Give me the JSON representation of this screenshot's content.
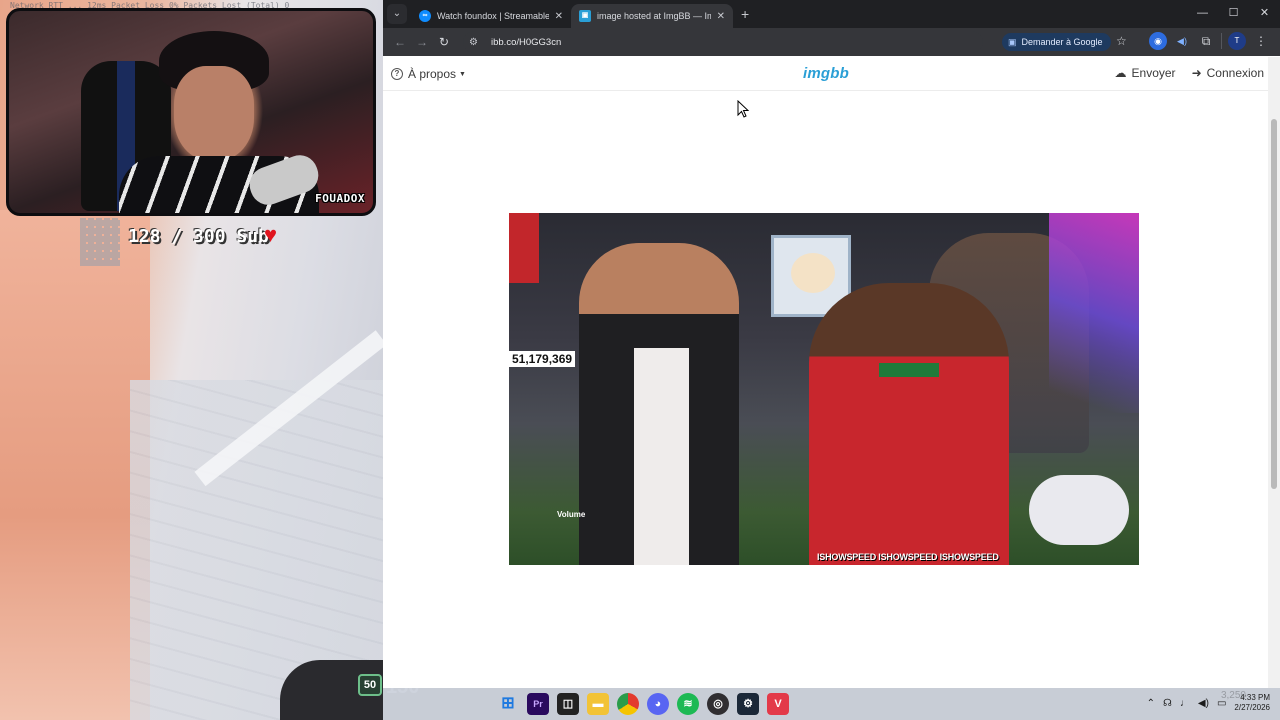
{
  "stream_overlay": {
    "stats_line": "Network RTT ... 12ms Packet Loss 0% Packets Lost (Total) 0",
    "cam_name": "FOUADOX",
    "sub_goal": "128 / 300 Sub",
    "hud_number": "50",
    "hud_ghost": "150"
  },
  "browser": {
    "tabs": [
      {
        "title": "Watch foundox | Streamable",
        "favicon": "streamable-icon",
        "active": false
      },
      {
        "title": "image hosted at ImgBB — ImgBB",
        "favicon": "imgbb-icon",
        "active": true
      }
    ],
    "url": "ibb.co/H0GG3cn",
    "google_button": "Demander à Google",
    "window_controls": [
      "minimize",
      "maximize",
      "close"
    ]
  },
  "imgbb": {
    "about_label": "À propos",
    "logo": "imgbb",
    "upload_label": "Envoyer",
    "login_label": "Connexion",
    "image": {
      "counter": "51,179,369",
      "volume_label": "Volume",
      "socials": "ISHOWSPEED ISHOWSPEED ISHOWSPEED"
    }
  },
  "taskbar": {
    "apps": [
      "windows-start",
      "premiere-pro",
      "vtop",
      "file-explorer",
      "chrome",
      "discord",
      "spotify",
      "obs",
      "steam",
      "valorant"
    ],
    "time": "4:33 PM",
    "date": "2/27/2026",
    "ghost_number": "3,250"
  },
  "colors": {
    "imgbb_blue": "#2a9fd6",
    "chrome_dark": "#35363a",
    "google_button_bg": "#1e3a5f"
  }
}
